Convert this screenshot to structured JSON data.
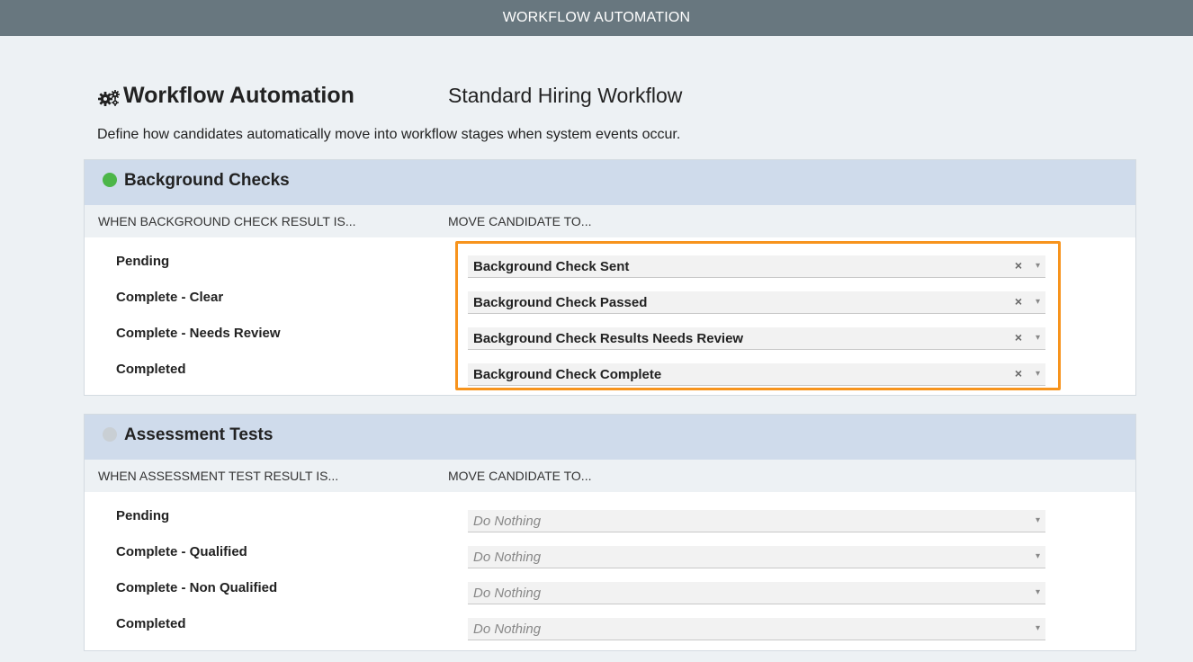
{
  "app": {
    "title": "WORKFLOW AUTOMATION"
  },
  "page": {
    "title": "Workflow Automation",
    "workflow_name": "Standard Hiring Workflow",
    "description": "Define how candidates automatically move into workflow stages when system events occur."
  },
  "sections": [
    {
      "title": "Background Checks",
      "status_color": "#4cb648",
      "col_left": "WHEN BACKGROUND CHECK RESULT IS...",
      "col_right": "MOVE CANDIDATE TO...",
      "rows": [
        {
          "label": "Pending",
          "value": "Background Check Sent",
          "clear": "×",
          "caret": "▾"
        },
        {
          "label": "Complete - Clear",
          "value": "Background Check Passed",
          "clear": "×",
          "caret": "▾"
        },
        {
          "label": "Complete - Needs Review",
          "value": "Background Check Results Needs Review",
          "clear": "×",
          "caret": "▾"
        },
        {
          "label": "Completed",
          "value": "Background Check Complete",
          "clear": "×",
          "caret": "▾"
        }
      ]
    },
    {
      "title": "Assessment Tests",
      "status_color": "#c9cfd4",
      "col_left": "WHEN ASSESSMENT TEST RESULT IS...",
      "col_right": "MOVE CANDIDATE TO...",
      "rows": [
        {
          "label": "Pending",
          "placeholder": "Do Nothing",
          "caret": "▾"
        },
        {
          "label": "Complete - Qualified",
          "placeholder": "Do Nothing",
          "caret": "▾"
        },
        {
          "label": "Complete - Non Qualified",
          "placeholder": "Do Nothing",
          "caret": "▾"
        },
        {
          "label": "Completed",
          "placeholder": "Do Nothing",
          "caret": "▾"
        }
      ]
    }
  ],
  "colors": {
    "topbar": "#68777f",
    "section_header": "#cfdbeb",
    "highlight": "#f7941d"
  }
}
